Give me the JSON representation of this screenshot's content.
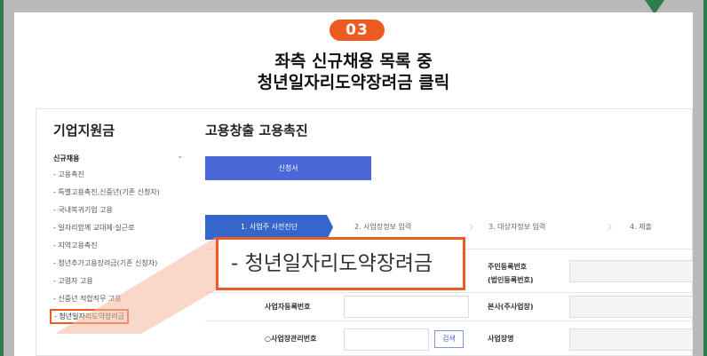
{
  "step_badge": "03",
  "headline": {
    "line1": "좌측 신규채용 목록 중",
    "line2": "청년일자리도약장려금 클릭"
  },
  "sidebar": {
    "title": "기업지원금",
    "category": "신규채용",
    "items": [
      "- 고용촉진",
      "- 특별고용촉진,신중년(기존 신청자)",
      "- 국내복귀기업 고용",
      "- 일자리함께 교대제·실근로",
      "- 지역고용촉진",
      "- 청년추가고용장려금(기존 신청자)",
      "- 고령자 고용",
      "- 신중년 적합직무 고용",
      "- 청년일자리도약장려금"
    ]
  },
  "main": {
    "title": "고용창출 고용촉진",
    "apply_button": "신청서",
    "steps": [
      "1. 사업주 사전진단",
      "2. 사업장정보 입력",
      "3. 대상자정보 입력",
      "4. 제출"
    ],
    "form": {
      "resident_no_label": "주민등록번호\n(법인등록번호)",
      "business_reg_label": "사업자등록번호",
      "hq_label": "본사(주사업장)",
      "workplace_no_label": "○사업장관리번호",
      "search_button": "검색",
      "workplace_name_label": "사업장명"
    }
  },
  "callout": "- 청년일자리도약장려금",
  "colors": {
    "accent": "#ee5b22",
    "primary_blue": "#4a67d8",
    "step_blue": "#3566c9",
    "frame_green": "#2e7d4f"
  }
}
